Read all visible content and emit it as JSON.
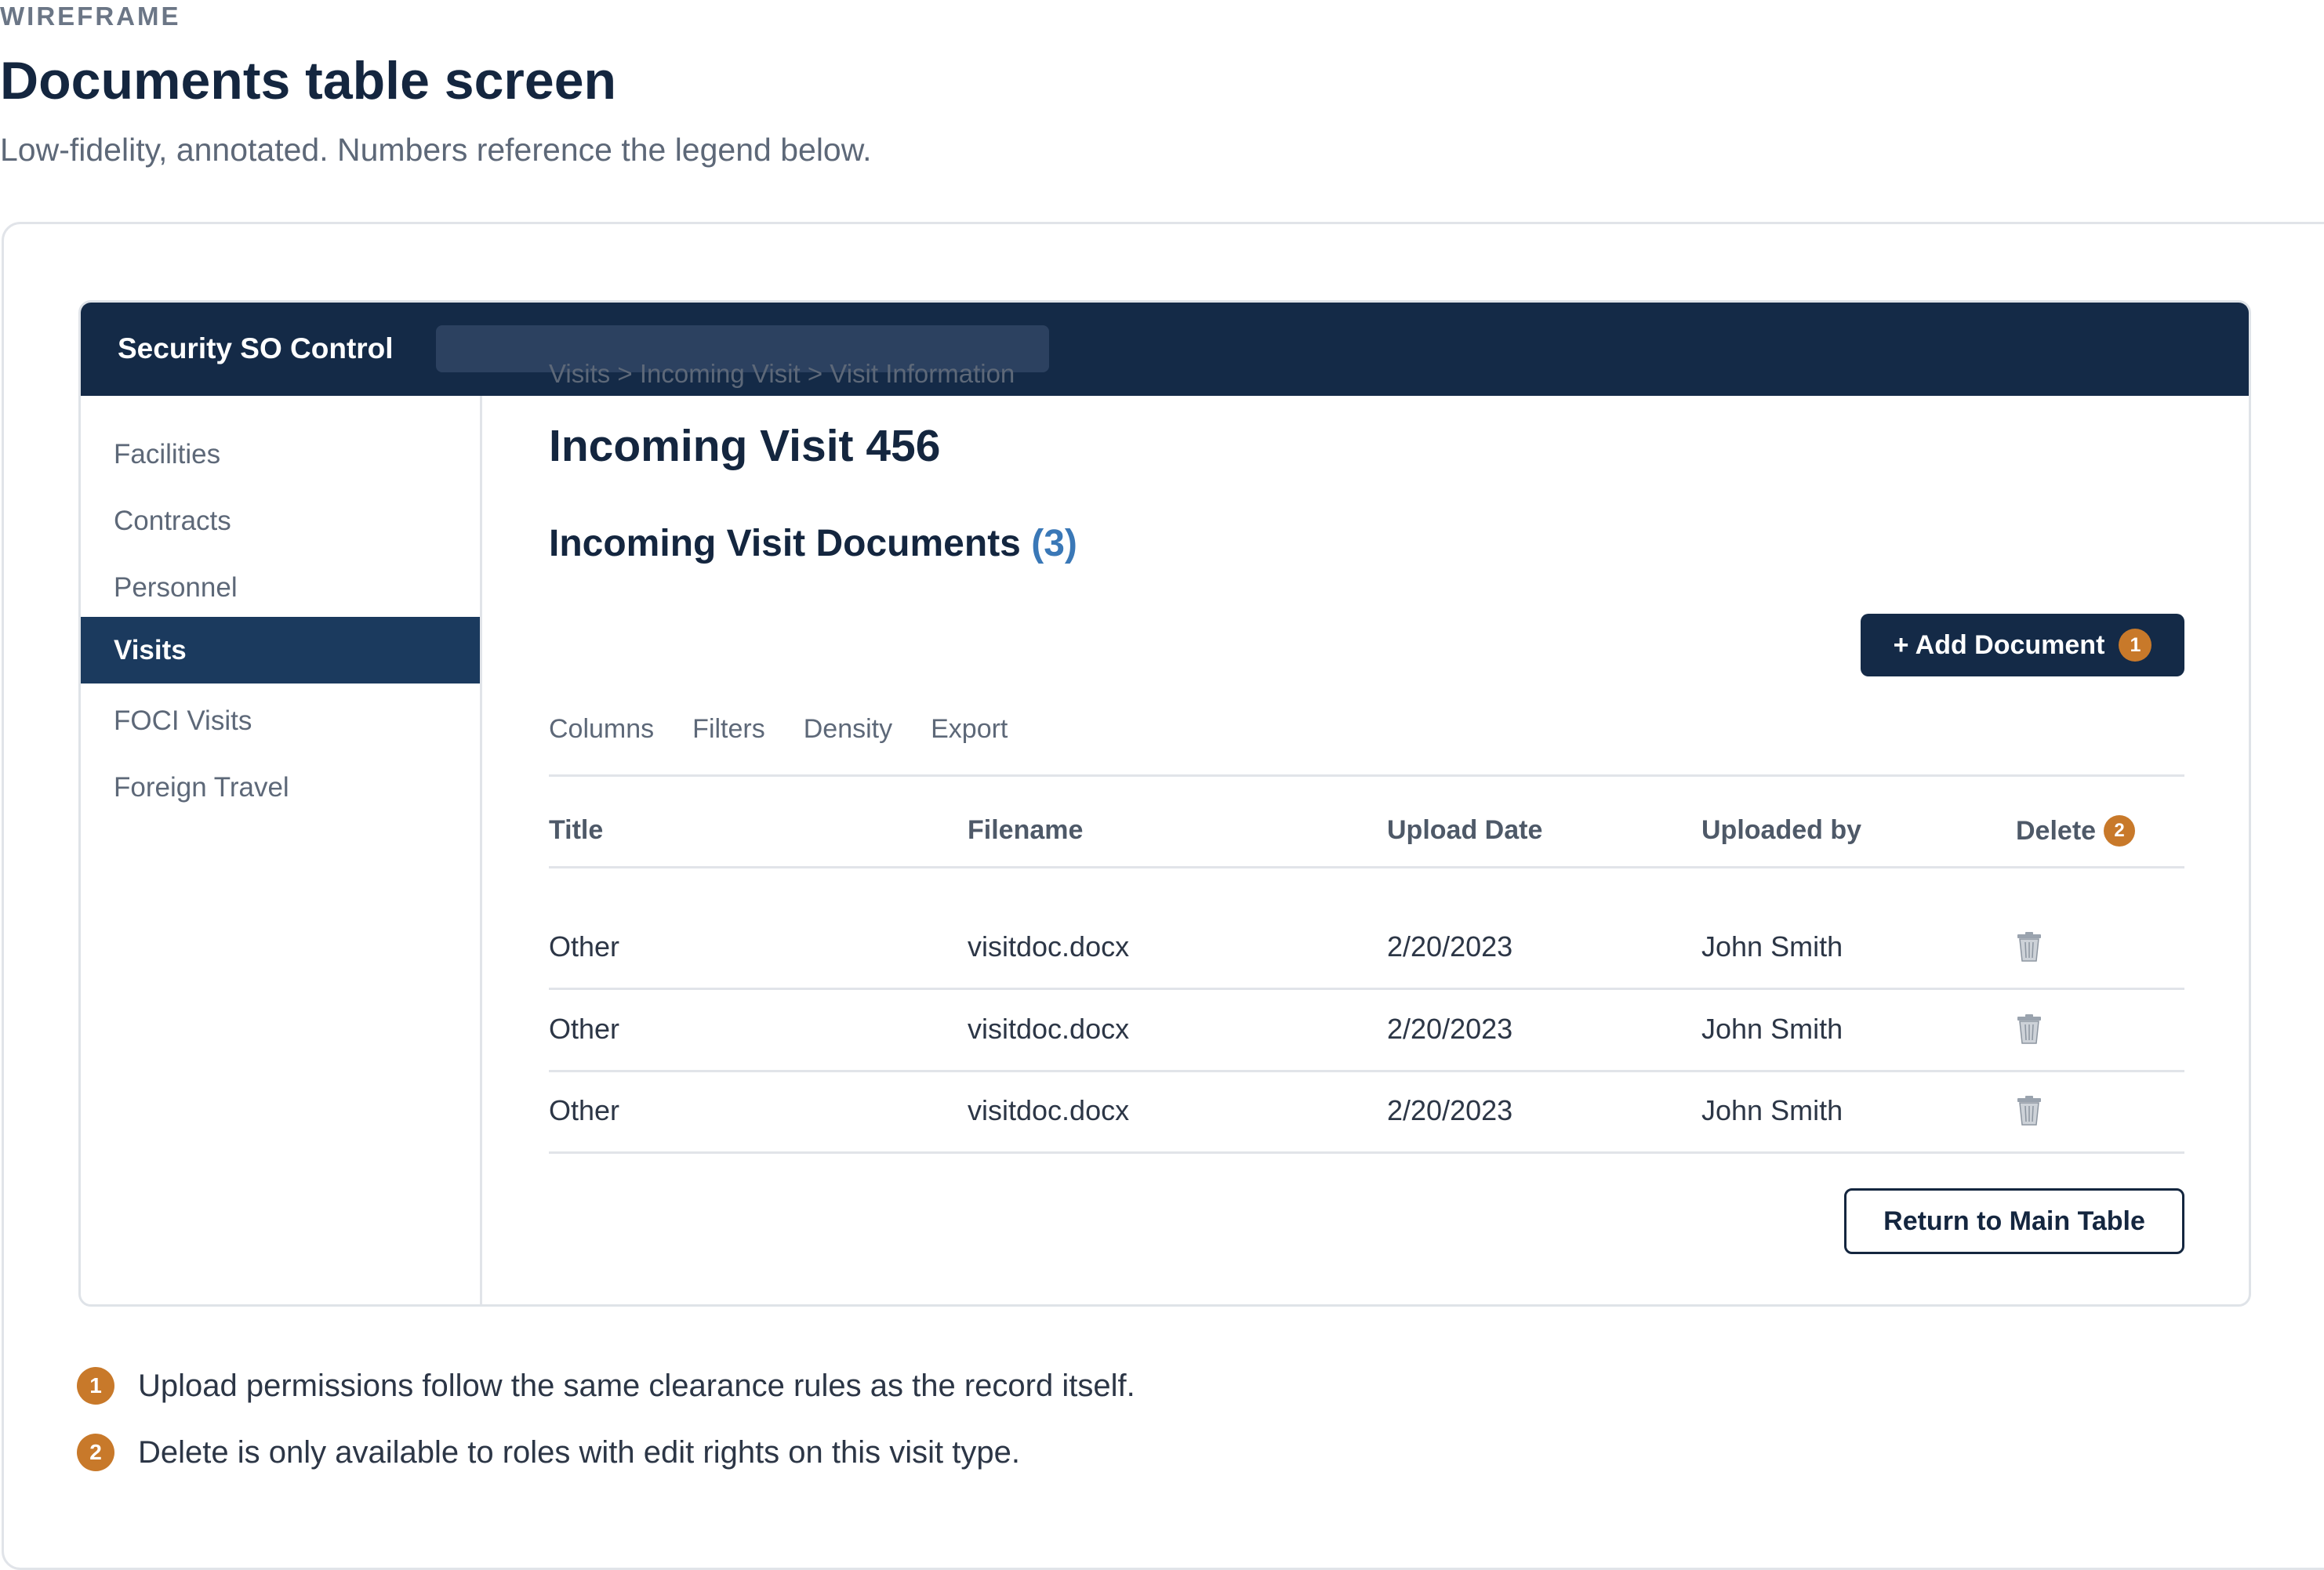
{
  "page": {
    "kicker": "WIREFRAME",
    "title": "Documents table screen",
    "subtitle": "Low-fidelity, annotated. Numbers reference the legend below."
  },
  "app": {
    "title": "Security SO Control"
  },
  "sidebar": {
    "items": [
      {
        "label": "Facilities"
      },
      {
        "label": "Contracts"
      },
      {
        "label": "Personnel"
      },
      {
        "label": "Visits"
      },
      {
        "label": "FOCI Visits"
      },
      {
        "label": "Foreign Travel"
      }
    ],
    "active": "Visits"
  },
  "content": {
    "breadcrumb": "Visits > Incoming Visit > Visit Information",
    "visit_title": "Incoming Visit 456",
    "section_title": "Incoming Visit Documents",
    "section_count": "(3)",
    "add_button": {
      "label": "+ Add Document",
      "badge": "1"
    },
    "tools": [
      "Columns",
      "Filters",
      "Density",
      "Export"
    ],
    "table": {
      "headers": [
        "Title",
        "Filename",
        "Upload Date",
        "Uploaded by",
        "Delete"
      ],
      "delete_badge": "2",
      "rows": [
        {
          "title": "Other",
          "filename": "visitdoc.docx",
          "date": "2/20/2023",
          "uploader": "John Smith",
          "delete_icon": "trash-icon"
        },
        {
          "title": "Other",
          "filename": "visitdoc.docx",
          "date": "2/20/2023",
          "uploader": "John Smith",
          "delete_icon": "trash-icon"
        },
        {
          "title": "Other",
          "filename": "visitdoc.docx",
          "date": "2/20/2023",
          "uploader": "John Smith",
          "delete_icon": "trash-icon"
        }
      ]
    },
    "return_button": "Return to Main Table"
  },
  "legend": [
    {
      "badge": "1",
      "text": "Upload permissions follow the same clearance rules as the record itself."
    },
    {
      "badge": "2",
      "text": "Delete is only available to roles with edit rights on this visit type."
    }
  ],
  "colors": {
    "navy": "#142a47",
    "accent_blue": "#3a78b7",
    "badge_orange": "#c8792a"
  }
}
